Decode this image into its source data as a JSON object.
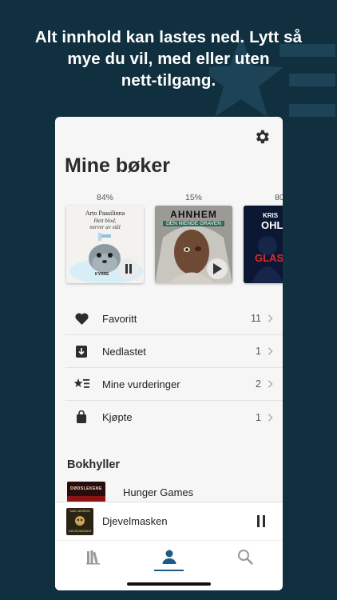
{
  "headline": "Alt innhold kan lastes ned. Lytt så\nmye du vil, med eller uten\nnett-tilgang.",
  "app": {
    "title": "Mine bøker",
    "books": [
      {
        "progress_label": "84%",
        "cover_author": "Arto Paasilinna",
        "cover_title_line1": "Hett blod,",
        "cover_title_line2": "nerver av stål",
        "cover_series": "KYRRE",
        "state": "playing"
      },
      {
        "progress_label": "15%",
        "cover_author": "AHNHEM",
        "cover_title": "DEN NIENDE GRAVEN",
        "state": "paused"
      },
      {
        "progress_label": "80",
        "cover_author": "KRIS",
        "cover_author2": "OHLS",
        "cover_title": "GLASS"
      }
    ],
    "list": [
      {
        "label": "Favoritt",
        "count": "11",
        "icon": "heart-icon"
      },
      {
        "label": "Nedlastet",
        "count": "1",
        "icon": "download-icon"
      },
      {
        "label": "Mine vurderinger",
        "count": "2",
        "icon": "star-list-icon"
      },
      {
        "label": "Kjøpte",
        "count": "1",
        "icon": "shopping-bag-icon"
      }
    ],
    "shelves_title": "Bokhyller",
    "shelf": {
      "label": "Hunger Games",
      "thumb_text": "DØDSLEKENE"
    },
    "player": {
      "title": "Djevelmasken",
      "thumb_author": "SAM LARSSON",
      "thumb_title": "DJEVELMASKEN"
    },
    "tabs": [
      {
        "name": "library-tab",
        "icon": "books-icon"
      },
      {
        "name": "profile-tab",
        "icon": "person-icon",
        "active": true
      },
      {
        "name": "search-tab",
        "icon": "search-icon"
      }
    ],
    "colors": {
      "background": "#11303f",
      "accent": "#1e5a87",
      "card": "#f6f6f6"
    }
  }
}
